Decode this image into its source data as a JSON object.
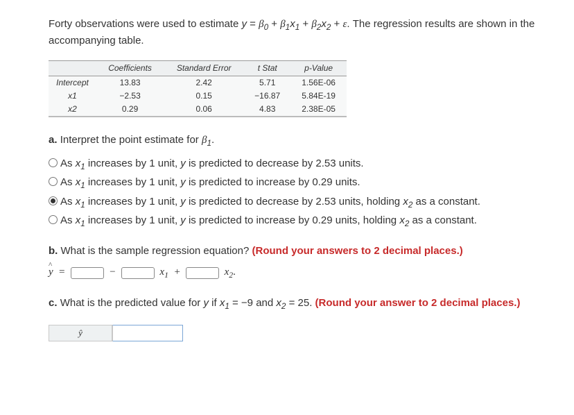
{
  "prompt": {
    "p1a": "Forty observations were used to estimate ",
    "p1b": ". The regression results are shown in the accompanying table."
  },
  "equation": {
    "y": "y",
    "eq": " = ",
    "b0": "β",
    "s0": "0",
    "plus": " + ",
    "b1": "β",
    "s1": "1",
    "x1": "x",
    "xs1": "1",
    "b2": "β",
    "s2": "2",
    "x2": "x",
    "xs2": "2",
    "eps": "ε"
  },
  "table": {
    "headers": {
      "coef": "Coefficients",
      "se": "Standard Error",
      "tstat": "t Stat",
      "pval": "p-Value"
    },
    "rows": [
      {
        "label": "Intercept",
        "coef": "13.83",
        "se": "2.42",
        "tstat": "5.71",
        "pval": "1.56E-06"
      },
      {
        "label": "x1",
        "coef": "−2.53",
        "se": "0.15",
        "tstat": "−16.87",
        "pval": "5.84E-19"
      },
      {
        "label": "x2",
        "coef": "0.29",
        "se": "0.06",
        "tstat": "4.83",
        "pval": "2.38E-05"
      }
    ]
  },
  "qa": {
    "label": "a.",
    "text": " Interpret the point estimate for ",
    "beta": "β",
    "sub": "1",
    "dot": "."
  },
  "options": [
    "As x1 increases by 1 unit, y is predicted to decrease by 2.53 units.",
    "As x1 increases by 1 unit, y is predicted to increase by 0.29 units.",
    "As x1 increases by 1 unit, y is predicted to decrease by 2.53 units, holding x2 as a constant.",
    "As x1 increases by 1 unit, y is predicted to increase by 0.29 units, holding x2 as a constant."
  ],
  "selectedOption": 2,
  "qb": {
    "label": "b.",
    "text": " What is the sample regression equation? ",
    "hint": "(Round your answers to 2 decimal places.)"
  },
  "eqrow": {
    "yhat": "y",
    "eq": "=",
    "minus": "−",
    "x1": "x",
    "s1": "1",
    "plus": "+",
    "x2": "x",
    "s2": "2",
    "dot": "."
  },
  "qc": {
    "label": "c.",
    "text1": " What is the predicted value for ",
    "y": "y",
    "if": " if ",
    "x1": "x",
    "s1": "1",
    "eq1": " = −9 and ",
    "x2": "x",
    "s2": "2",
    "eq2": " = 25. ",
    "hint": "(Round your answer to 2 decimal places.)"
  },
  "final_label": "ŷ"
}
